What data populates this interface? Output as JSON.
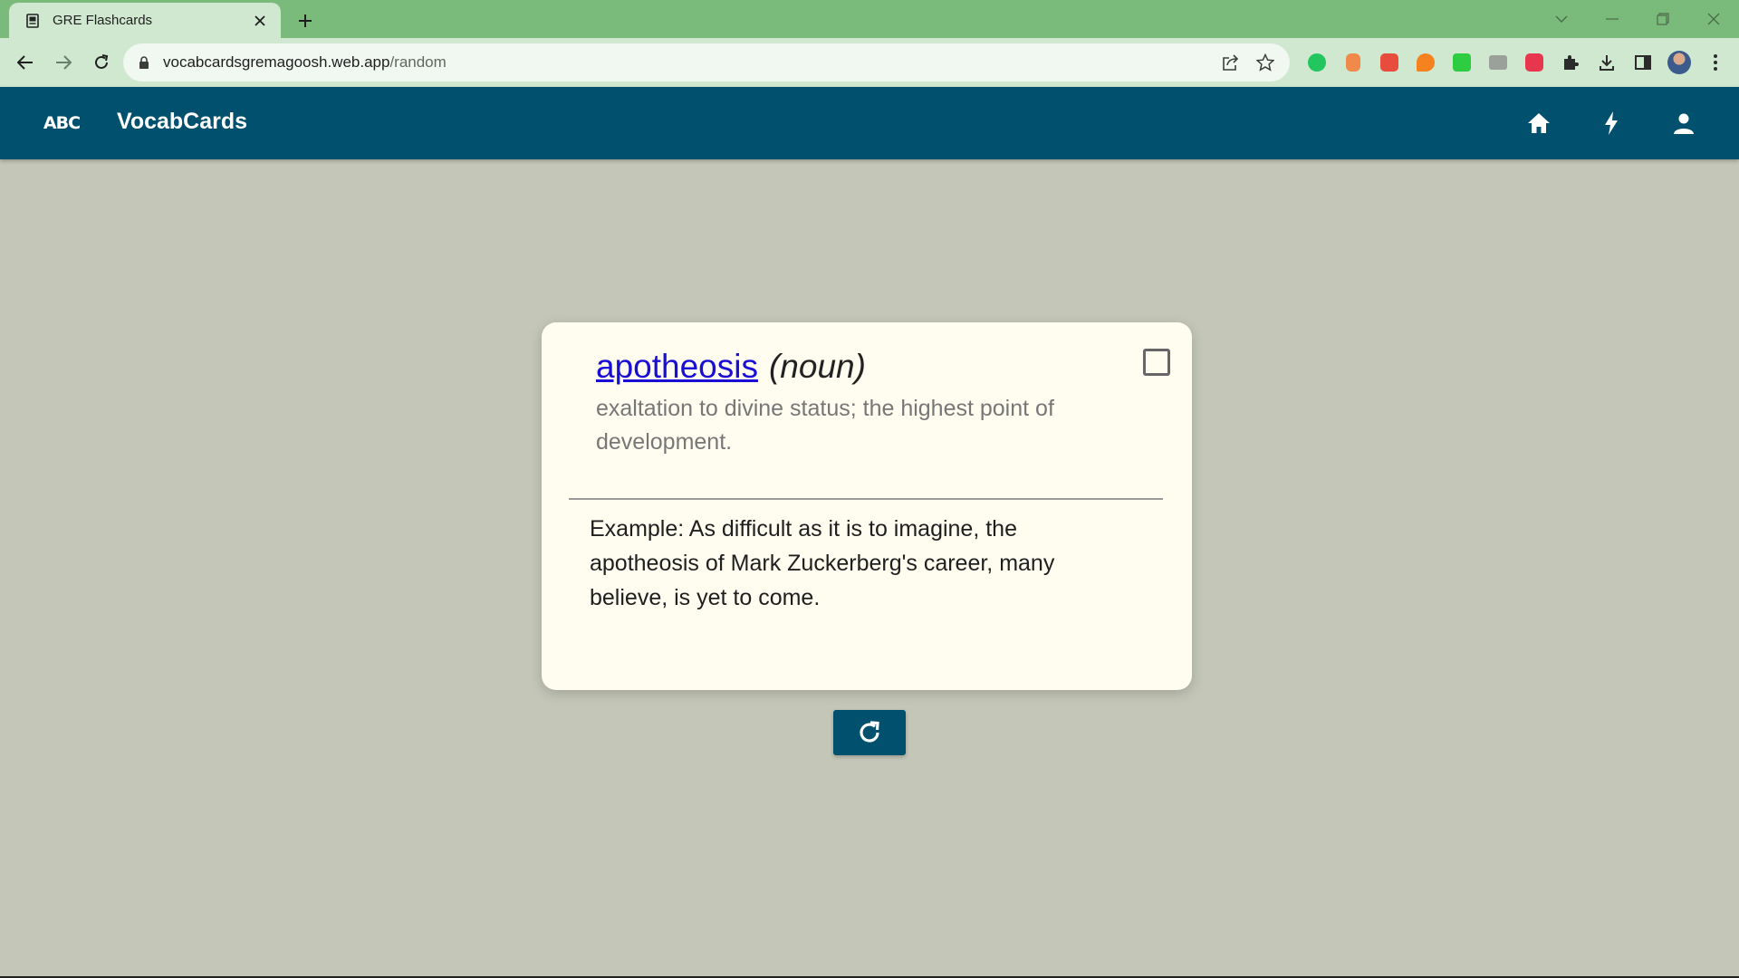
{
  "browser": {
    "tab_title": "GRE Flashcards",
    "url_host": "vocabcardsgremagoosh.web.app",
    "url_path": "/random",
    "extensions": [
      {
        "name": "green-extension-icon",
        "color": "#22c55e"
      },
      {
        "name": "orange-jar-extension-icon",
        "color": "#f08a4b"
      },
      {
        "name": "red-square-extension-icon",
        "color": "#e74c3c"
      },
      {
        "name": "orange-drops-extension-icon",
        "color": "#f5821f"
      },
      {
        "name": "green-lock-extension-icon",
        "color": "#2ecc40"
      },
      {
        "name": "grey-mail-extension-icon",
        "color": "#9aa09a"
      },
      {
        "name": "red-grid-extension-icon",
        "color": "#e8364f"
      }
    ]
  },
  "app": {
    "logo_text": "ABC",
    "title": "VocabCards",
    "header_color": "#00506e"
  },
  "card": {
    "word": "apotheosis",
    "part_of_speech": "(noun)",
    "definition": "exaltation to divine status; the highest point of development.",
    "example": "Example: As difficult as it is to imagine, the apotheosis of Mark Zuckerberg's career, many believe, is yet to come.",
    "checked": false
  }
}
